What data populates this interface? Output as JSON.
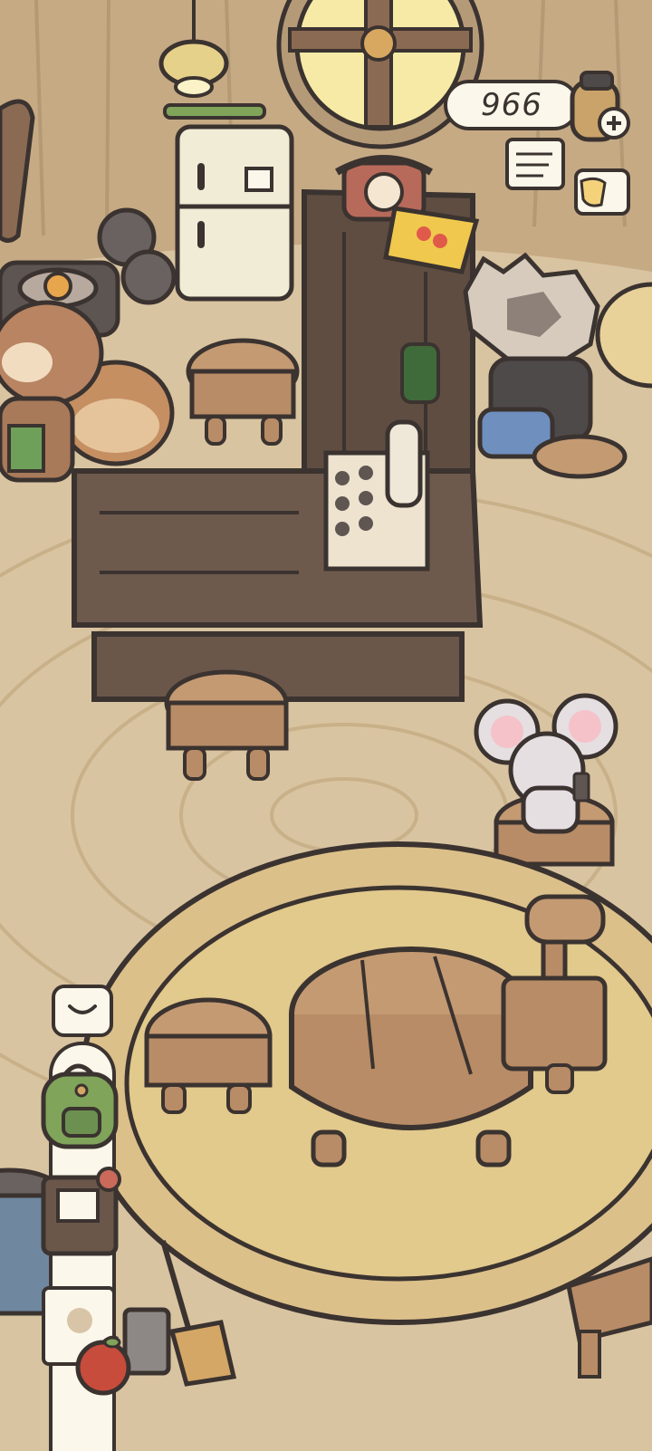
{
  "hud": {
    "currency_value": "966",
    "currency_icon": "acorn-coin-icon",
    "add_icon": "plus-icon",
    "journal_icon": "journal-icon",
    "coffee_icon": "coffee-cup-icon"
  },
  "sidebar": {
    "toggle_icon": "chevron-down-icon",
    "items": [
      {
        "icon": "backpack-icon"
      },
      {
        "icon": "recipe-book-icon"
      },
      {
        "icon": "notes-icon"
      },
      {
        "icon": "apple-icon"
      }
    ]
  },
  "colors": {
    "floor": "#d9c4a1",
    "wall": "#c9ad86",
    "outline": "#3b3330",
    "counter": "#6e5a4c",
    "rug": "#e1c88a",
    "ui_panel": "#fbf7ea"
  }
}
